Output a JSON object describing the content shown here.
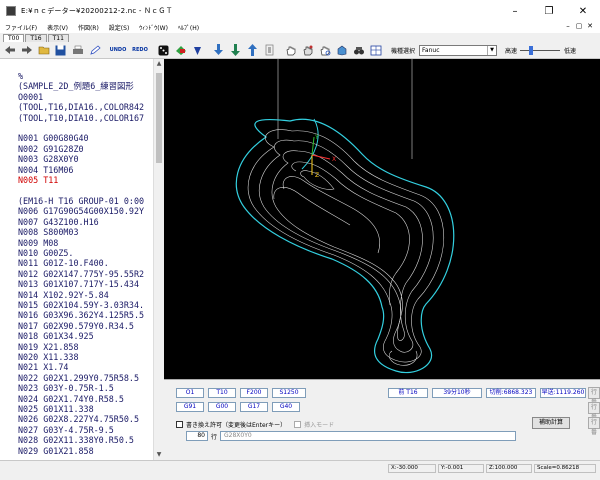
{
  "window": {
    "title": "E:¥ｎｃデーター¥20200212-2.nc - ＮｃＧＴ",
    "controls": [
      "–",
      "❐",
      "✕"
    ]
  },
  "menu": {
    "items": [
      "ファイル(F)",
      "表示(V)",
      "作図(R)",
      "設定(S)",
      "ｳｨﾝﾄﾞｳ(W)",
      "ﾍﾙﾌﾟ(H)"
    ],
    "mdi": [
      "–",
      "▢",
      "✕"
    ]
  },
  "tabs": [
    "T00",
    "T16",
    "T11"
  ],
  "toolbar": {
    "undo": "UNDO",
    "redo": "REDO",
    "machine_label": "機種選択",
    "machine_value": "Fanuc",
    "speed_high": "高速",
    "speed_low": "低速",
    "speed_level": 0.25
  },
  "nc_program": [
    {
      "text": "%"
    },
    {
      "text": "(SAMPLE_2D_例題6_練習図形"
    },
    {
      "text": "O0001"
    },
    {
      "text": "(TOOL,T16,DIA16.,COLOR842"
    },
    {
      "text": "(TOOL,T10,DIA10.,COLOR167"
    },
    {
      "text": ""
    },
    {
      "text": "N001 G00G80G40"
    },
    {
      "text": "N002 G91G28Z0"
    },
    {
      "text": "N003 G28X0Y0"
    },
    {
      "text": "N004 T16M06"
    },
    {
      "text": "N005 T11",
      "current": true
    },
    {
      "text": ""
    },
    {
      "text": "(EM16-H T16 GROUP-01 0:00"
    },
    {
      "text": "N006 G17G90G54G00X150.92Y"
    },
    {
      "text": "N007 G43Z100.H16"
    },
    {
      "text": "N008 S800M03"
    },
    {
      "text": "N009 M08"
    },
    {
      "text": "N010 G00Z5."
    },
    {
      "text": "N011 G01Z-10.F400."
    },
    {
      "text": "N012 G02X147.775Y-95.55R2"
    },
    {
      "text": "N013 G01X107.717Y-15.434"
    },
    {
      "text": "N014 X102.92Y-5.84"
    },
    {
      "text": "N015 G02X104.59Y-3.03R34."
    },
    {
      "text": "N016 G03X96.362Y4.125R5.5"
    },
    {
      "text": "N017 G02X90.579Y0.R34.5"
    },
    {
      "text": "N018 G01X34.925"
    },
    {
      "text": "N019 X21.858"
    },
    {
      "text": "N020 X11.338"
    },
    {
      "text": "N021 X1.74"
    },
    {
      "text": "N022 G02X1.299Y0.75R58.5"
    },
    {
      "text": "N023 G03Y-0.75R-1.5"
    },
    {
      "text": "N024 G02X1.74Y0.R58.5"
    },
    {
      "text": "N025 G01X11.338"
    },
    {
      "text": "N026 G02X8.227Y4.75R50.5"
    },
    {
      "text": "N027 G03Y-4.75R-9.5"
    },
    {
      "text": "N028 G02X11.338Y0.R50.5"
    },
    {
      "text": "N029 G01X21.858"
    }
  ],
  "axis_labels": {
    "x": "X",
    "y": "Y",
    "z": "Z"
  },
  "info": {
    "codes_row1": [
      "O1",
      "T10",
      "F200",
      "S1250"
    ],
    "codes_row2": [
      "G91",
      "G00",
      "G17",
      "G40"
    ],
    "prev_tool": "前 T16",
    "elapsed": "39分10秒",
    "cut_length": "切削:6868.323",
    "feed_length": "早送:1119.260",
    "overwrite_label": "書き換え許可（変更後はEnterキー）",
    "insert_mode_label": "挿入モード",
    "calc_button": "補助計算",
    "line_number": "80",
    "line_label": "行",
    "line_content": "G28X0Y0",
    "side_buttons": [
      "行番",
      "行番",
      "行番"
    ]
  },
  "status": {
    "x": "X:-30.000",
    "y": "Y:-0.001",
    "z": "Z:100.000",
    "scale": "Scale=0.86218"
  }
}
